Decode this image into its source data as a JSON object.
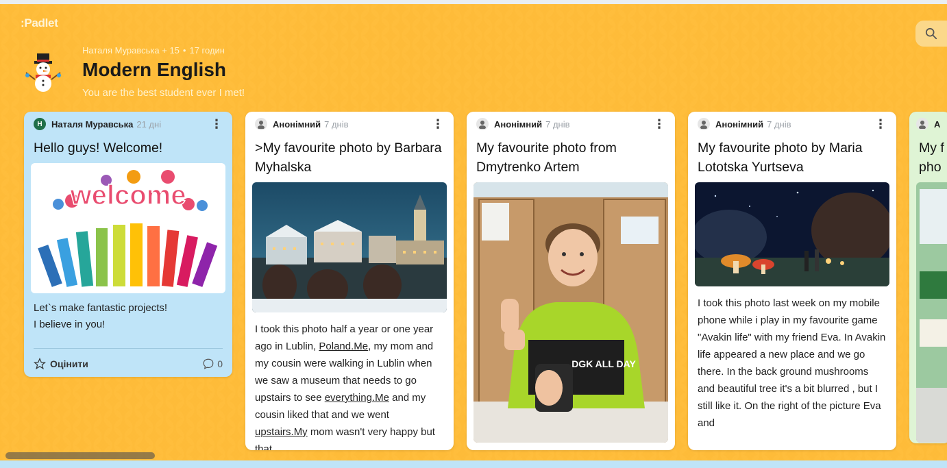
{
  "app": {
    "logo": ":Padlet"
  },
  "board": {
    "byline_authors": "Наталя Муравська + 15",
    "byline_time": "17 годин",
    "title": "Modern English",
    "subtitle": "You are the best student ever I met!"
  },
  "colors": {
    "background": "#f7a51c",
    "accent_blue": "#bfe4f8",
    "accent_green": "#dff4d5"
  },
  "posts": [
    {
      "author": "Наталя Муравська",
      "author_initial": "Н",
      "time": "21 дні",
      "title": "Hello guys! Welcome!",
      "image_text": "welcome",
      "body_lines": [
        "Let`s make fantastic projects!",
        "I believe in you!"
      ],
      "rate_label": "Оцінити",
      "comment_count": "0"
    },
    {
      "author": "Анонімний",
      "time": "7 днів",
      "title": ">My favourite photo by Barbara Myhalska",
      "body_parts": [
        "I took this photo half a year or one year ago in Lublin, ",
        "Poland.Me",
        ", my mom and my cousin were walking in Lublin when we saw a museum that needs to go upstairs to see ",
        "everything.Me",
        " and my cousin liked that and we went ",
        "upstairs.My",
        " mom wasn't very happy but that"
      ]
    },
    {
      "author": "Анонімний",
      "time": "7 днів",
      "title": "My favourite photo from Dmytrenko Artem",
      "shirt_text": "DGK ALL DAY"
    },
    {
      "author": "Анонімний",
      "time": "7 днів",
      "title": "My favourite photo by Maria Lototska Yurtseva",
      "body": "I took this photo last week on my mobile phone while i play in my favourite game \"Avakin life\" with my friend Eva. In Avakin life appeared a new place and we go there. In the back ground mushrooms and beautiful tree it's a bit blurred , but I still like it. On the right of the picture Eva and"
    },
    {
      "author": "А",
      "title": "My f pho",
      "title_line1": "My f",
      "title_line2": "pho"
    }
  ]
}
